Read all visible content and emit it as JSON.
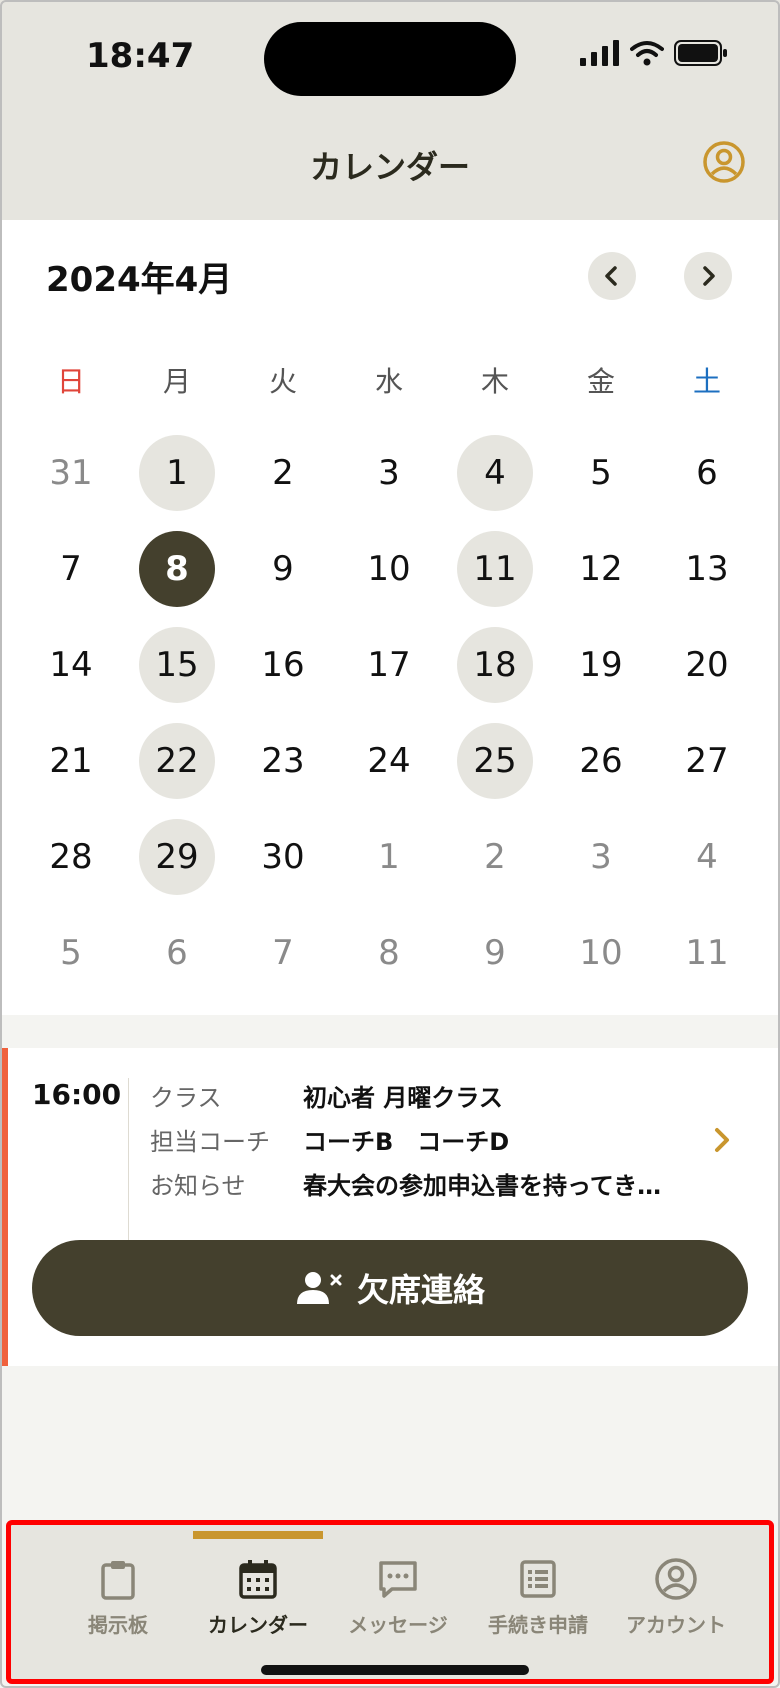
{
  "status_bar": {
    "time": "18:47"
  },
  "header": {
    "title": "カレンダー",
    "account_icon": "account-circle-icon"
  },
  "calendar": {
    "month_label": "2024年4月",
    "weekdays": [
      "日",
      "月",
      "火",
      "水",
      "木",
      "金",
      "土"
    ],
    "weeks": [
      [
        {
          "d": "31",
          "other": true
        },
        {
          "d": "1",
          "event": true
        },
        {
          "d": "2"
        },
        {
          "d": "3"
        },
        {
          "d": "4",
          "event": true
        },
        {
          "d": "5"
        },
        {
          "d": "6"
        }
      ],
      [
        {
          "d": "7"
        },
        {
          "d": "8",
          "selected": true
        },
        {
          "d": "9"
        },
        {
          "d": "10"
        },
        {
          "d": "11",
          "event": true
        },
        {
          "d": "12"
        },
        {
          "d": "13"
        }
      ],
      [
        {
          "d": "14"
        },
        {
          "d": "15",
          "event": true
        },
        {
          "d": "16"
        },
        {
          "d": "17"
        },
        {
          "d": "18",
          "event": true
        },
        {
          "d": "19"
        },
        {
          "d": "20"
        }
      ],
      [
        {
          "d": "21"
        },
        {
          "d": "22",
          "event": true
        },
        {
          "d": "23"
        },
        {
          "d": "24"
        },
        {
          "d": "25",
          "event": true
        },
        {
          "d": "26"
        },
        {
          "d": "27"
        }
      ],
      [
        {
          "d": "28"
        },
        {
          "d": "29",
          "event": true
        },
        {
          "d": "30"
        },
        {
          "d": "1",
          "other": true
        },
        {
          "d": "2",
          "other": true
        },
        {
          "d": "3",
          "other": true
        },
        {
          "d": "4",
          "other": true
        }
      ],
      [
        {
          "d": "5",
          "other": true
        },
        {
          "d": "6",
          "other": true
        },
        {
          "d": "7",
          "other": true
        },
        {
          "d": "8",
          "other": true
        },
        {
          "d": "9",
          "other": true
        },
        {
          "d": "10",
          "other": true
        },
        {
          "d": "11",
          "other": true
        }
      ]
    ]
  },
  "event": {
    "time": "16:00",
    "class_label": "クラス",
    "class_value": "初心者 月曜クラス",
    "coach_label": "担当コーチ",
    "coach_value": "コーチB　コーチD",
    "notice_label": "お知らせ",
    "notice_value": "春大会の参加申込書を持ってき…",
    "absence_button": "欠席連絡"
  },
  "tabs": [
    {
      "label": "掲示板",
      "icon": "clipboard-icon"
    },
    {
      "label": "カレンダー",
      "icon": "calendar-icon",
      "active": true
    },
    {
      "label": "メッセージ",
      "icon": "message-icon"
    },
    {
      "label": "手続き申請",
      "icon": "list-document-icon"
    },
    {
      "label": "アカウント",
      "icon": "account-circle-icon"
    }
  ],
  "colors": {
    "accent": "#c9962e",
    "dark": "#44402d",
    "event_accent": "#f0613c",
    "sunday": "#e0453a",
    "saturday": "#1c6fc0"
  }
}
